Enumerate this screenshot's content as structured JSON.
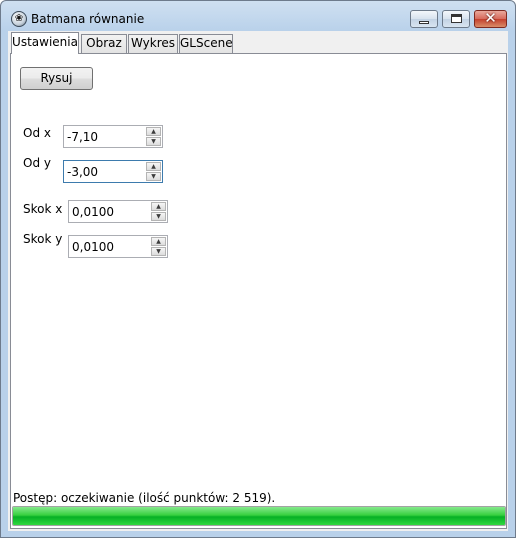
{
  "window": {
    "title": "Batmana równanie",
    "icon": "paw-icon"
  },
  "tabs": [
    {
      "label": "Ustawienia",
      "active": true
    },
    {
      "label": "Obraz",
      "active": false
    },
    {
      "label": "Wykres",
      "active": false
    },
    {
      "label": "GLScene",
      "active": false
    }
  ],
  "settings": {
    "draw_button": "Rysuj",
    "od_x": {
      "label": "Od x",
      "value": "-7,10"
    },
    "od_y": {
      "label": "Od y",
      "value": "-3,00"
    },
    "skok_x": {
      "label": "Skok x",
      "value": "0,0100"
    },
    "skok_y": {
      "label": "Skok y",
      "value": "0,0100"
    }
  },
  "status": {
    "text": "Postęp: oczekiwanie (ilość punktów: 2 519).",
    "progress_percent": 100,
    "progress_color": "#06b025"
  }
}
